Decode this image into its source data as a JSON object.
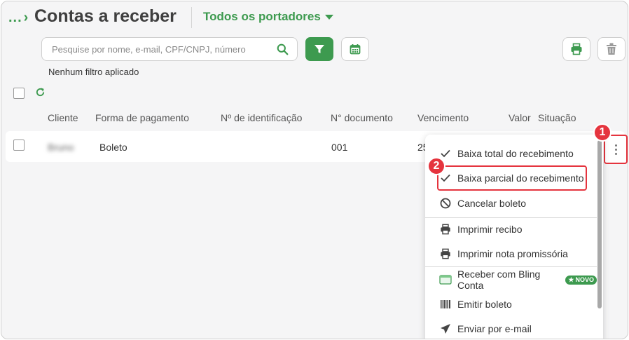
{
  "header": {
    "breadcrumb": "...",
    "title": "Contas a receber",
    "portadores": "Todos os portadores"
  },
  "search": {
    "placeholder": "Pesquise por nome, e-mail, CPF/CNPJ, número"
  },
  "filter_status": "Nenhum filtro aplicado",
  "table": {
    "columns": [
      "Cliente",
      "Forma de pagamento",
      "Nº de identificação",
      "N° documento",
      "Vencimento",
      "Valor",
      "Situação"
    ],
    "rows": [
      {
        "cliente": "Bruno",
        "forma_pagamento": "Boleto",
        "identificacao": "",
        "documento": "001",
        "vencimento": "25"
      }
    ]
  },
  "menu": {
    "items": [
      {
        "label": "Baixa total do recebimento",
        "icon": "check-icon"
      },
      {
        "label": "Baixa parcial do recebimento",
        "icon": "check-icon"
      },
      {
        "label": "Cancelar boleto",
        "icon": "ban-icon"
      },
      {
        "label": "Imprimir recibo",
        "icon": "printer-icon"
      },
      {
        "label": "Imprimir nota promissória",
        "icon": "printer-icon"
      },
      {
        "label": "Receber com Bling Conta",
        "icon": "bling-account-icon",
        "badge": "NOVO"
      },
      {
        "label": "Emitir boleto",
        "icon": "barcode-icon"
      },
      {
        "label": "Enviar por e-mail",
        "icon": "send-icon"
      }
    ]
  },
  "callouts": {
    "one": "1",
    "two": "2"
  },
  "colors": {
    "brand_green": "#3d9a4f",
    "callout_red": "#e5343e"
  }
}
